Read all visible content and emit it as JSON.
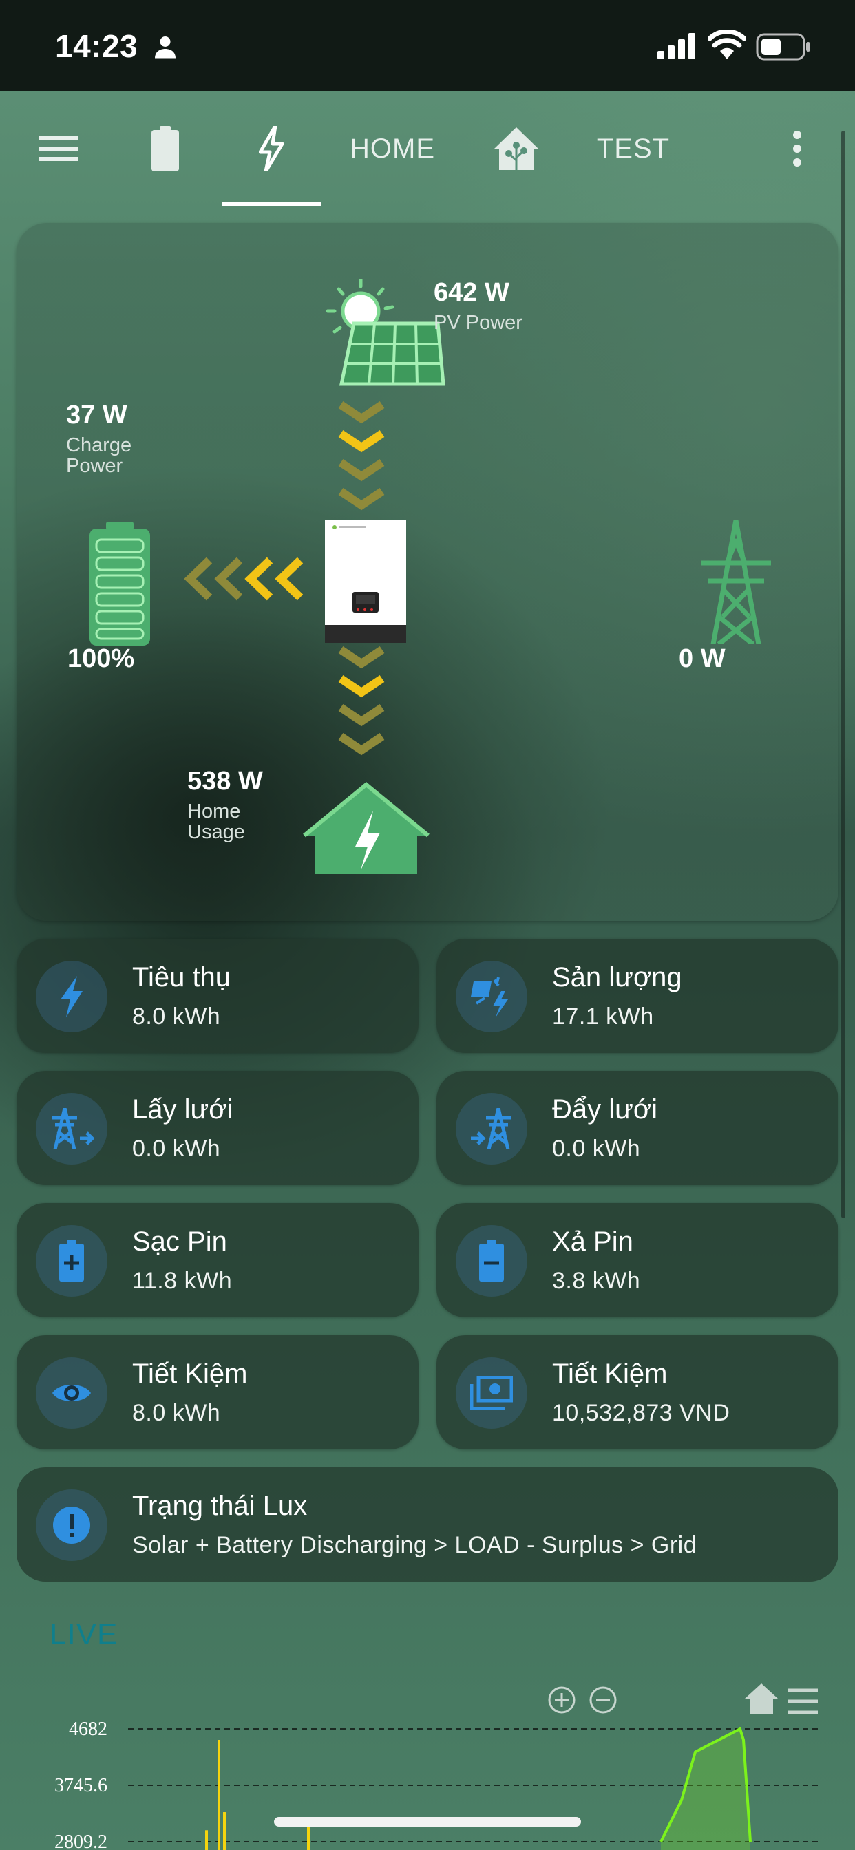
{
  "status_bar": {
    "time": "14:23",
    "icons": [
      "person-icon",
      "signal-icon",
      "wifi-icon",
      "battery-icon"
    ]
  },
  "toolbar": {
    "menu_icon": "hamburger-icon",
    "tabs": [
      {
        "type": "icon",
        "icon": "battery-icon"
      },
      {
        "type": "icon",
        "icon": "lightning-icon",
        "selected": true
      },
      {
        "type": "text",
        "label": "HOME"
      },
      {
        "type": "icon",
        "icon": "home-assistant-icon"
      },
      {
        "type": "text",
        "label": "TEST"
      }
    ],
    "more_icon": "dots-vertical-icon"
  },
  "flow": {
    "pv": {
      "value": "642 W",
      "label": "PV Power"
    },
    "charge": {
      "value": "37 W",
      "label_line1": "Charge",
      "label_line2": "Power"
    },
    "battery": {
      "soc": "100%"
    },
    "grid": {
      "value": "0 W"
    },
    "home": {
      "value": "538 W",
      "label_line1": "Home",
      "label_line2": "Usage"
    },
    "colors": {
      "flow_active": "#f2c416",
      "flow_dim": "#8f8a3a",
      "icon_green": "#4cae6e"
    }
  },
  "stats": [
    {
      "title": "Tiêu thụ",
      "value": "8.0 kWh",
      "icon": "lightning-icon"
    },
    {
      "title": "Sản lượng",
      "value": "17.1 kWh",
      "icon": "solar-power-icon"
    },
    {
      "title": "Lấy lưới",
      "value": "0.0 kWh",
      "icon": "transmission-tower-import-icon"
    },
    {
      "title": "Đẩy lưới",
      "value": "0.0 kWh",
      "icon": "transmission-tower-export-icon"
    },
    {
      "title": "Sạc Pin",
      "value": "11.8 kWh",
      "icon": "battery-plus-icon"
    },
    {
      "title": "Xả Pin",
      "value": "3.8 kWh",
      "icon": "battery-minus-icon"
    },
    {
      "title": "Tiết Kiệm",
      "value": "8.0 kWh",
      "icon": "eye-icon"
    },
    {
      "title": "Tiết Kiệm",
      "value": "10,532,873 VND",
      "icon": "cash-multiple-icon"
    }
  ],
  "status": {
    "title": "Trạng thái Lux",
    "value": "Solar + Battery Discharging > LOAD - Surplus > Grid",
    "icon": "alert-circle-icon"
  },
  "live": {
    "title": "LIVE"
  },
  "chart_data": {
    "type": "line",
    "title": "",
    "y_ticks": [
      "4682",
      "3745.6",
      "2809.2"
    ],
    "ylim": [
      2809.2,
      4682
    ],
    "series": [
      {
        "color": "#f5d40f",
        "values": [
          3000,
          4500,
          3300,
          3100
        ]
      },
      {
        "color": "#7cf21c",
        "values": [
          2809.2,
          3500,
          4300,
          4682,
          4500,
          2809.2
        ]
      }
    ],
    "toolbar_icons": [
      "zoom-in-icon",
      "zoom-out-icon",
      "reset-zoom-home-icon",
      "menu-icon"
    ]
  }
}
